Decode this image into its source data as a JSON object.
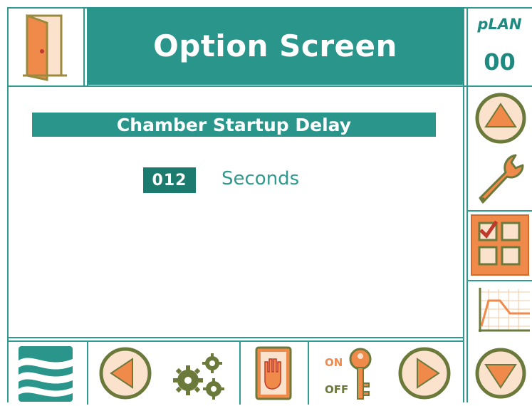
{
  "header": {
    "title": "Option Screen",
    "plan_label": "pLAN",
    "plan_value": "00"
  },
  "main": {
    "section_title": "Chamber Startup Delay",
    "value": "012",
    "unit": "Seconds"
  },
  "toolbar": {
    "on_label": "ON",
    "off_label": "OFF"
  },
  "icons": {
    "exit": "door-icon",
    "up": "arrow-up-icon",
    "service": "wrench-icon",
    "options": "checklist-grid-icon",
    "graph": "graph-icon",
    "down": "arrow-down-icon",
    "logo": "waves-logo-icon",
    "left": "arrow-left-icon",
    "settings": "gears-icon",
    "stop": "hand-stop-icon",
    "onoff": "key-icon",
    "right": "arrow-right-icon"
  },
  "colors": {
    "teal": "#2a958b",
    "dark_teal": "#1b7b6f",
    "orange": "#f08a4b",
    "olive": "#6b7a3b"
  }
}
